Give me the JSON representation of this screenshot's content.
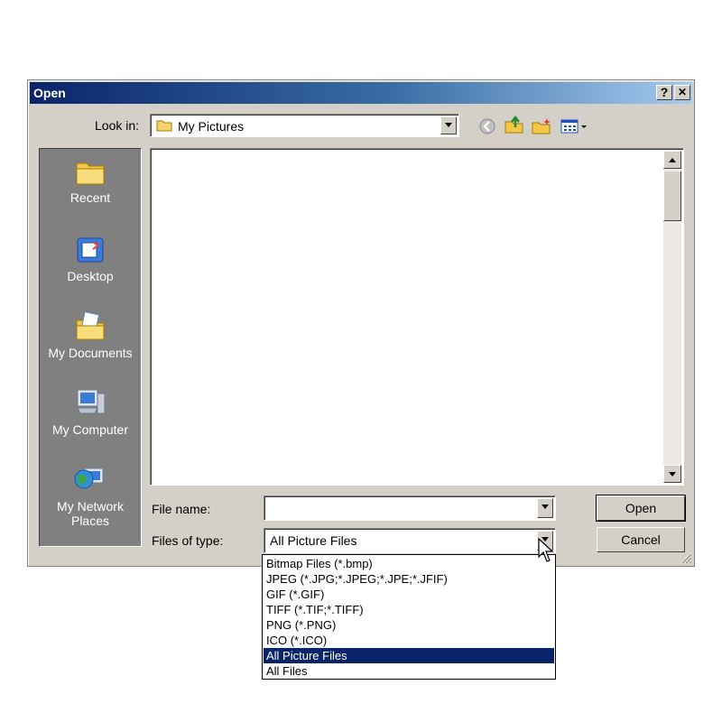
{
  "window": {
    "title": "Open",
    "help_btn": "?",
    "close_btn": "✕"
  },
  "lookin": {
    "label": "Look in:",
    "value": "My Pictures"
  },
  "toolbar": {
    "icons": [
      "back-icon",
      "up-folder-icon",
      "new-folder-icon",
      "view-menu-icon"
    ]
  },
  "places": [
    {
      "label": "Recent",
      "icon": "recent-folder-icon"
    },
    {
      "label": "Desktop",
      "icon": "desktop-icon"
    },
    {
      "label": "My Documents",
      "icon": "my-documents-icon"
    },
    {
      "label": "My Computer",
      "icon": "my-computer-icon"
    },
    {
      "label": "My Network",
      "label2": "Places",
      "icon": "network-places-icon"
    }
  ],
  "filename": {
    "label": "File name:",
    "value": ""
  },
  "filetype": {
    "label": "Files of type:",
    "value": "All Picture Files",
    "options": [
      "Bitmap Files (*.bmp)",
      "JPEG (*.JPG;*.JPEG;*.JPE;*.JFIF)",
      "GIF (*.GIF)",
      "TIFF (*.TIF;*.TIFF)",
      "PNG (*.PNG)",
      "ICO (*.ICO)",
      "All Picture Files",
      "All Files"
    ],
    "selected_index": 6
  },
  "buttons": {
    "open": "Open",
    "cancel": "Cancel"
  },
  "colors": {
    "title_start": "#0a246a",
    "title_end": "#a6caf0",
    "face": "#d4d0c8",
    "places_bg": "#808080",
    "selection": "#0a246a"
  }
}
